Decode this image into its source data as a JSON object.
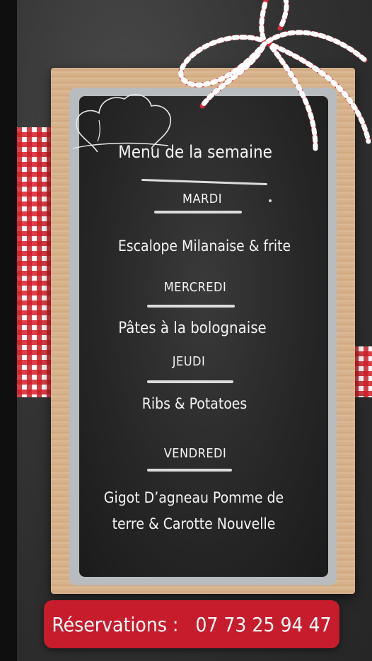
{
  "menu": {
    "title": "Menu de la semaine",
    "days": [
      {
        "day": "MARDI",
        "dish": "Escalope Milanaise & frite"
      },
      {
        "day": "MERCREDI",
        "dish": "Pâtes à la bolognaise"
      },
      {
        "day": "JEUDI",
        "dish": "Ribs & Potatoes"
      },
      {
        "day": "VENDREDI",
        "dish_line1": "Gigot D’agneau Pomme de",
        "dish_line2": "terre & Carotte Nouvelle"
      }
    ]
  },
  "reservations": {
    "label": "Réservations :",
    "phone": "07 73 25 94 47"
  },
  "decor": {
    "icons": [
      "chef-hat-icon",
      "ribbon-bow-icon",
      "gingham-cloth"
    ],
    "colors": {
      "accent": "#c61c2c",
      "chalk": "#f4f4f4",
      "board": "#262626",
      "wood": "#d4ae86"
    }
  }
}
